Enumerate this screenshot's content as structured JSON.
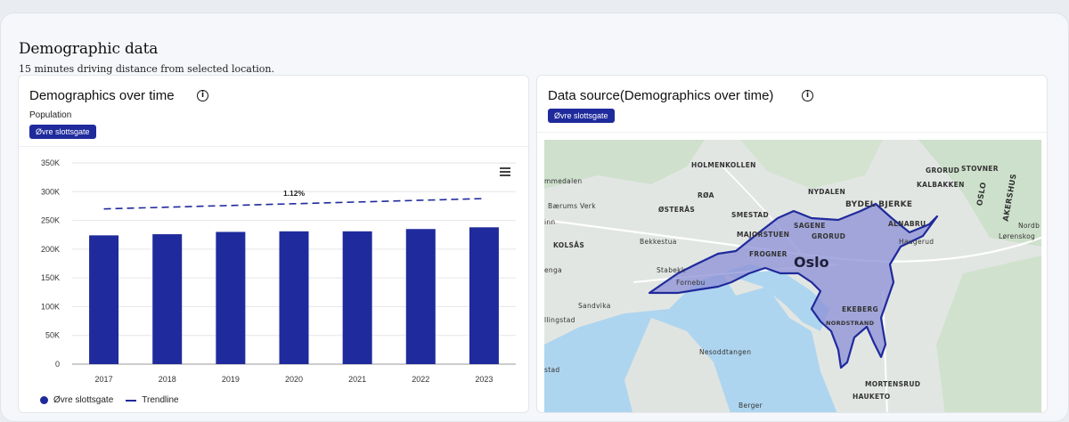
{
  "section": {
    "title": "Demographic data",
    "subtitle": "15 minutes driving distance from selected location."
  },
  "left_card": {
    "title": "Demographics over time",
    "label": "Population",
    "chip": "Øvre slottsgate",
    "legend": {
      "series": "Øvre slottsgate",
      "trend": "Trendline"
    }
  },
  "right_card": {
    "title": "Data source(Demographics over time)",
    "chip": "Øvre slottsgate"
  },
  "colors": {
    "accent": "#1f2a9c",
    "region_fill": "#8b8fd6"
  },
  "chart_data": {
    "type": "bar",
    "categories": [
      "2017",
      "2018",
      "2019",
      "2020",
      "2021",
      "2022",
      "2023"
    ],
    "series": [
      {
        "name": "Øvre slottsgate",
        "values": [
          224000,
          226000,
          230000,
          231000,
          231000,
          235000,
          238000
        ]
      }
    ],
    "trendline": {
      "name": "Trendline",
      "values": [
        270000,
        273000,
        276000,
        279000,
        282000,
        285000,
        288000
      ],
      "annotation": "1.12%"
    },
    "yticks": [
      "0",
      "50K",
      "100K",
      "150K",
      "200K",
      "250K",
      "300K",
      "350K"
    ],
    "ylim": [
      0,
      350000
    ],
    "grid": true,
    "legend": "bottom-left"
  },
  "map": {
    "labels": [
      "HOLMENKOLLEN",
      "mmedalen",
      "RØA",
      "Bærums Verk",
      "ØSTERÅS",
      "SMESTAD",
      "inn",
      "KOLSÅS",
      "Bekkestua",
      "FROGNER",
      "Oslo",
      "STORO",
      "GRORUD",
      "STOVNER",
      "KALBAKKEN",
      "NYDALEN",
      "BYDEL BJERKE",
      "ALNABRU",
      "Haugerud",
      "Lørenskog",
      "Nordb",
      "OSLO",
      "AKERSHUS",
      "Stabekk",
      "Fornebu",
      "enga",
      "Sandvika",
      "llingstad",
      "EKEBERG",
      "NORDSTRAND",
      "Nesoddtangen",
      "stad",
      "MORTENSRUD",
      "HAUKETO",
      "Berger",
      "SAGENE",
      "MAJORSTUEN"
    ]
  }
}
